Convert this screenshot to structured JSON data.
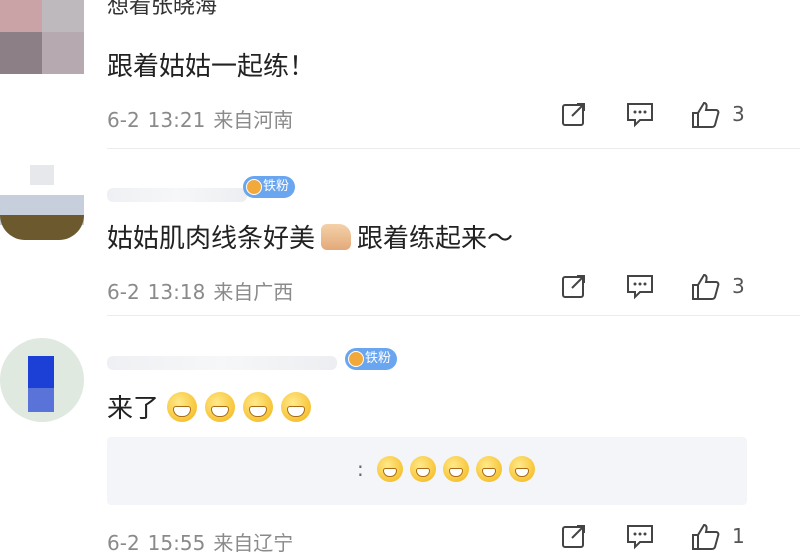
{
  "comments": [
    {
      "username": "想看张晓海",
      "text": "跟着姑姑一起练！",
      "date": "6-2",
      "time": "13:21",
      "location": "来自河南",
      "likes": "3"
    },
    {
      "badge": "铁粉",
      "text_before": "姑姑肌肉线条好美",
      "text_after": "跟着练起来～",
      "date": "6-2",
      "time": "13:18",
      "location": "来自广西",
      "likes": "3"
    },
    {
      "badge": "铁粉",
      "text": "来了",
      "reply_prefix": ":",
      "date": "6-2",
      "time": "15:55",
      "location": "来自辽宁",
      "likes": "1"
    }
  ],
  "icons": {
    "share": "share-icon",
    "comment": "comment-icon",
    "like": "thumbs-up-icon",
    "grin": "grinning-emoji-icon",
    "thumb": "thumbs-up-emoji-icon"
  }
}
